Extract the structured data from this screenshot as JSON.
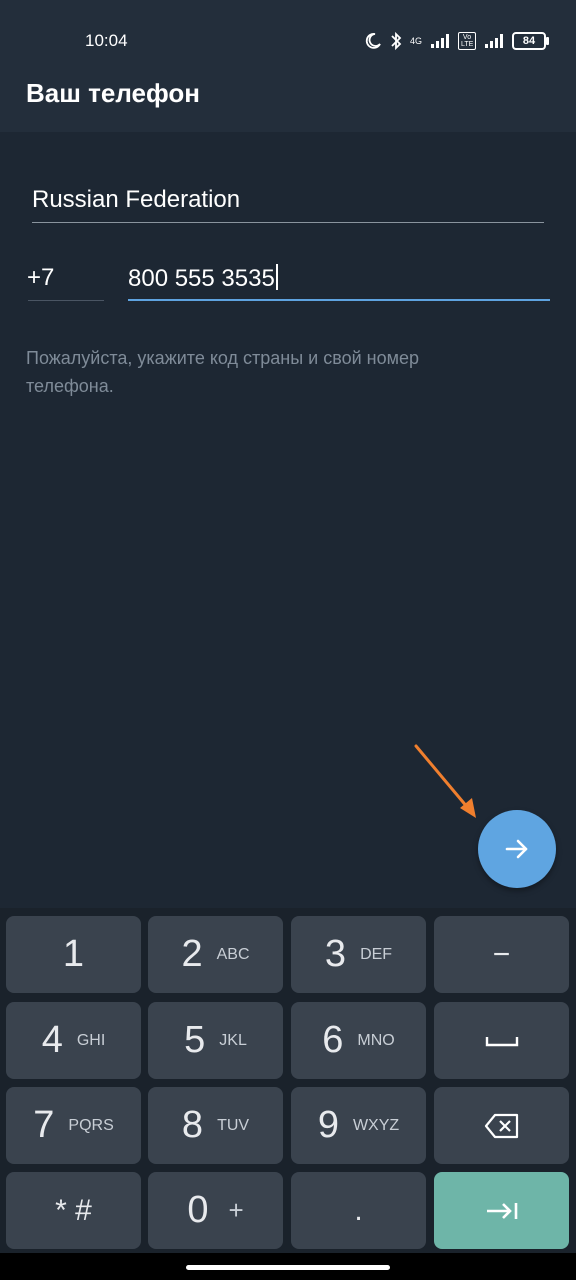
{
  "status_bar": {
    "time": "10:04",
    "network_4g": "4G",
    "volte": "Vo LTE",
    "battery": "84",
    "icons": [
      "moon-icon",
      "bluetooth-icon",
      "signal-icon",
      "battery-icon"
    ]
  },
  "app_bar": {
    "title": "Ваш телефон"
  },
  "form": {
    "country": "Russian Federation",
    "country_code": "+7",
    "phone_number": "800 555 3535",
    "hint": "Пожалуйста, укажите код страны и свой номер телефона."
  },
  "fab": {
    "icon": "arrow-right-icon",
    "color": "#5fa5e1"
  },
  "annotation": {
    "color": "#f07f2e"
  },
  "keyboard": {
    "keys": [
      {
        "digit": "1",
        "letters": ""
      },
      {
        "digit": "2",
        "letters": "ABC"
      },
      {
        "digit": "3",
        "letters": "DEF"
      },
      {
        "digit": "−",
        "letters": ""
      },
      {
        "digit": "4",
        "letters": "GHI"
      },
      {
        "digit": "5",
        "letters": "JKL"
      },
      {
        "digit": "6",
        "letters": "MNO"
      },
      {
        "digit": "",
        "letters": ""
      },
      {
        "digit": "7",
        "letters": "PQRS"
      },
      {
        "digit": "8",
        "letters": "TUV"
      },
      {
        "digit": "9",
        "letters": "WXYZ"
      },
      {
        "digit": "",
        "letters": ""
      },
      {
        "digit": "* #",
        "letters": ""
      },
      {
        "digit": "0",
        "letters": "+"
      },
      {
        "digit": ".",
        "letters": ""
      },
      {
        "digit": "",
        "letters": ""
      }
    ]
  }
}
